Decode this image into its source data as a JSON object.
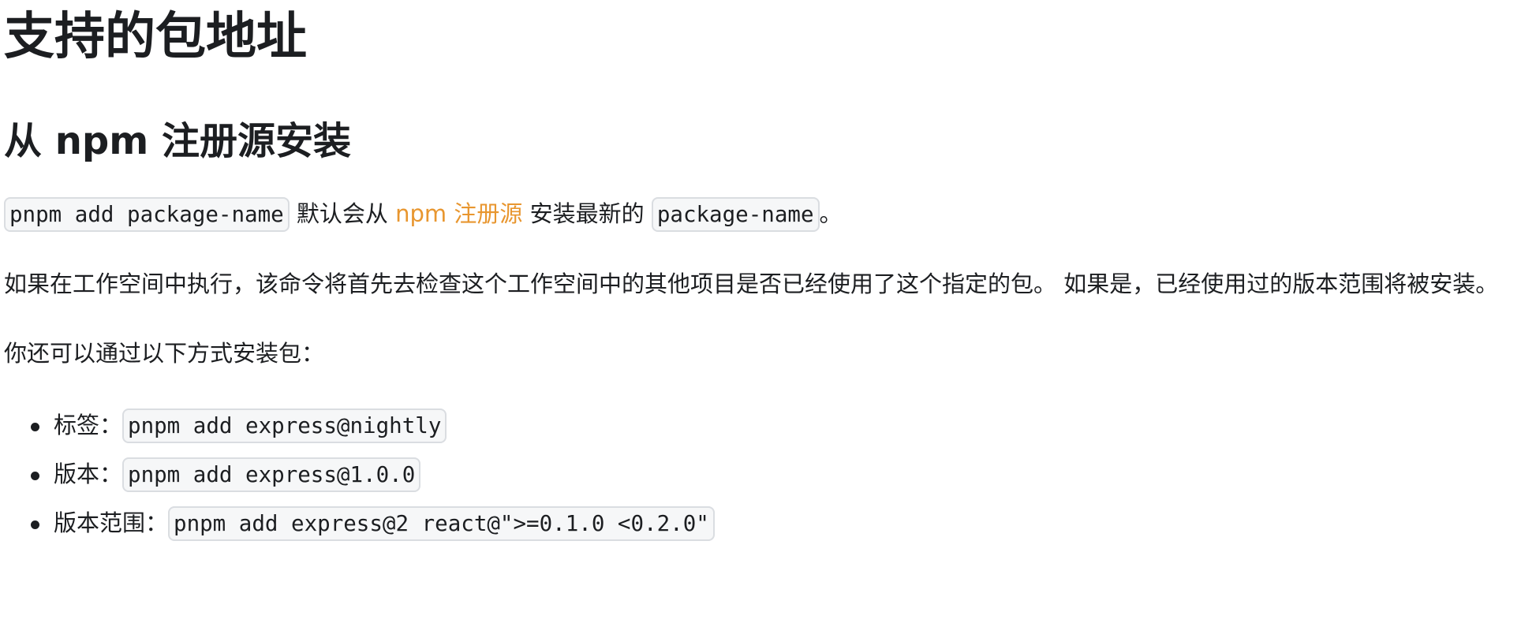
{
  "page": {
    "title": "支持的包地址",
    "section_title": "从 npm 注册源安装"
  },
  "intro": {
    "command": "pnpm add package-name",
    "text_before_link": " 默认会从 ",
    "link_text": "npm 注册源",
    "text_after_link": " 安装最新的 ",
    "package_code": "package-name",
    "end_punct": "。"
  },
  "workspace_note": "如果在工作空间中执行，该命令将首先去检查这个工作空间中的其他项目是否已经使用了这个指定的包。 如果是，已经使用过的版本范围将被安装。",
  "lead": "你还可以通过以下方式安装包：",
  "variants": [
    {
      "label": "标签：",
      "command": "pnpm add express@nightly"
    },
    {
      "label": "版本：",
      "command": "pnpm add express@1.0.0"
    },
    {
      "label": "版本范围：",
      "command": "pnpm add express@2 react@\">=0.1.0 <0.2.0\""
    }
  ],
  "colors": {
    "text": "#1c1e21",
    "link": "#e8962f",
    "code_background": "#f6f7f8",
    "code_border": "#dadde1"
  }
}
